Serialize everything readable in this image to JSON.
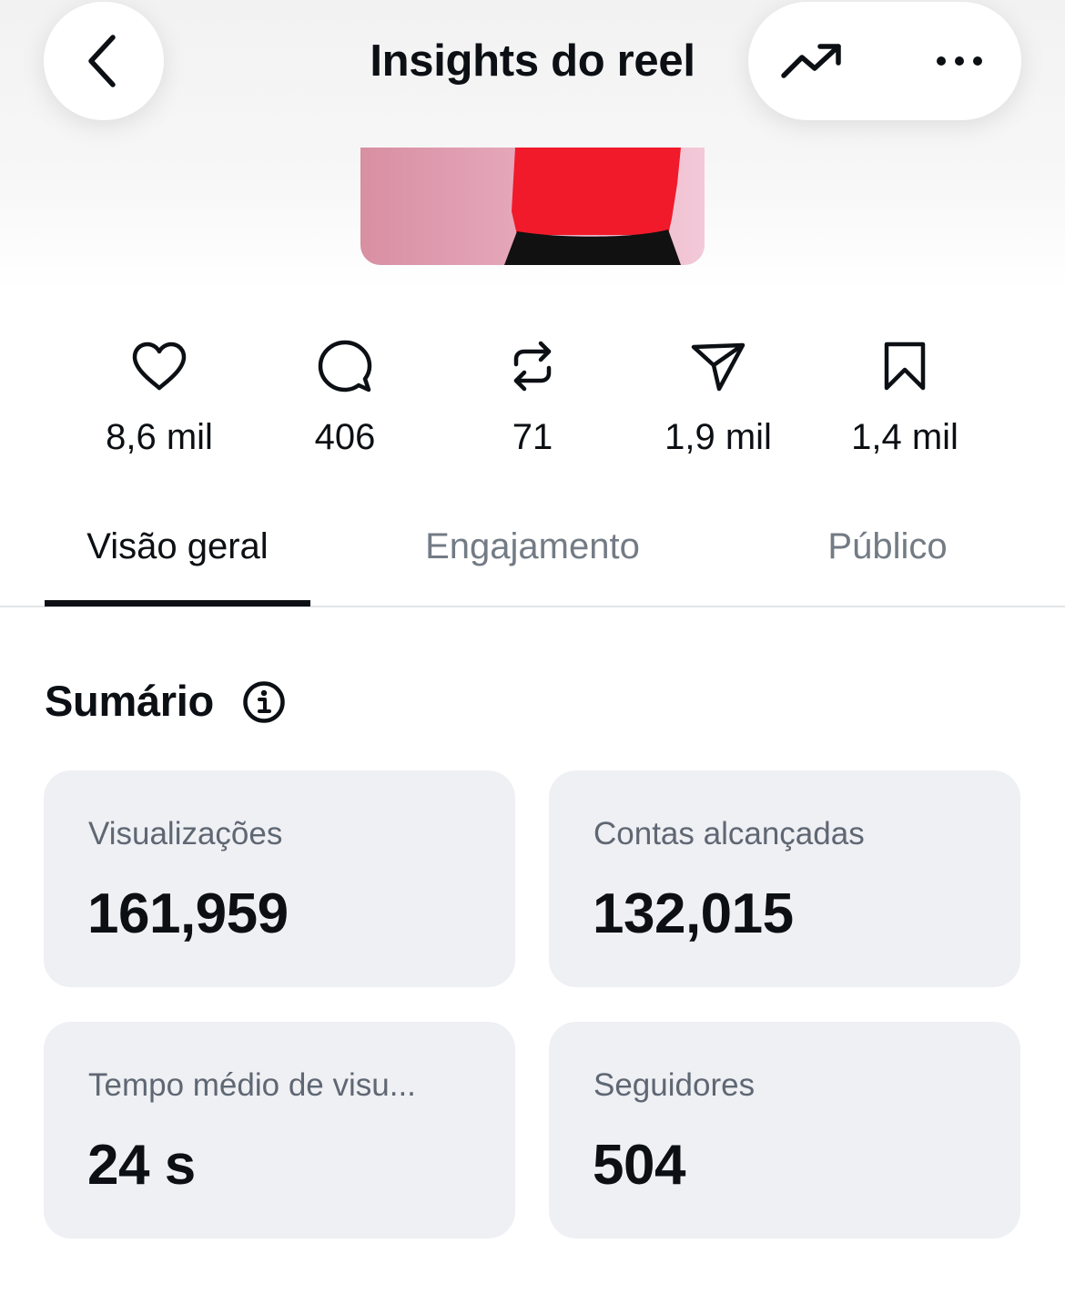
{
  "header": {
    "title": "Insights do reel",
    "back_icon": "chevron-left-icon",
    "trend_icon": "trending-up-icon",
    "more_icon": "more-horizontal-icon"
  },
  "reel": {
    "thumbnail_colors": {
      "background": "#e7a9bd",
      "shirt": "#f01a2a",
      "pants": "#111111"
    }
  },
  "interactions": [
    {
      "icon": "heart-icon",
      "value": "8,6 mil"
    },
    {
      "icon": "comment-icon",
      "value": "406"
    },
    {
      "icon": "repost-icon",
      "value": "71"
    },
    {
      "icon": "share-icon",
      "value": "1,9 mil"
    },
    {
      "icon": "bookmark-icon",
      "value": "1,4 mil"
    }
  ],
  "tabs": [
    {
      "label": "Visão geral",
      "active": true
    },
    {
      "label": "Engajamento",
      "active": false
    },
    {
      "label": "Público",
      "active": false
    }
  ],
  "summary": {
    "title": "Sumário",
    "info_icon": "info-icon",
    "cards": [
      {
        "label": "Visualizações",
        "value": "161,959"
      },
      {
        "label": "Contas alcançadas",
        "value": "132,015"
      },
      {
        "label": "Tempo médio de visu...",
        "value": "24 s"
      },
      {
        "label": "Seguidores",
        "value": "504"
      }
    ]
  },
  "colors": {
    "text_primary": "#0c1014",
    "text_secondary": "#737b85",
    "card_background": "#eff0f4",
    "divider": "#e3e5e8"
  }
}
